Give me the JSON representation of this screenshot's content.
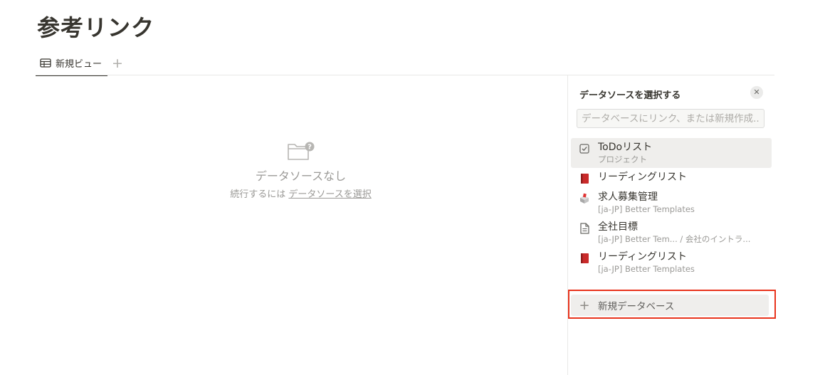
{
  "page": {
    "title": "参考リンク"
  },
  "tabs": {
    "view_label": "新規ビュー",
    "add_symbol": "+"
  },
  "empty_state": {
    "title": "データソースなし",
    "subtitle_prefix": "続行するには ",
    "link_label": "データソースを選択"
  },
  "panel": {
    "title": "データソースを選択する",
    "close_symbol": "✕",
    "search_placeholder": "データベースにリンク、または新規作成...",
    "items": [
      {
        "icon": "checkbox-icon",
        "title": "ToDoリスト",
        "subtitle": "プロジェクト",
        "selected": true
      },
      {
        "icon": "book-icon",
        "title": "リーディングリスト",
        "subtitle": ""
      },
      {
        "icon": "ballot-box-icon",
        "title": "求人募集管理",
        "subtitle": "[ja-JP] Better Templates"
      },
      {
        "icon": "document-icon",
        "title": "全社目標",
        "subtitle": "[ja-JP] Better Tem...  / 会社のイントラ..."
      },
      {
        "icon": "book-icon",
        "title": "リーディングリスト",
        "subtitle": "[ja-JP] Better Templates"
      }
    ],
    "new_database_label": "新規データベース",
    "new_database_symbol": "+"
  },
  "colors": {
    "highlight": "#e8331c",
    "text": "#37352f",
    "muted": "#9b9a97"
  }
}
